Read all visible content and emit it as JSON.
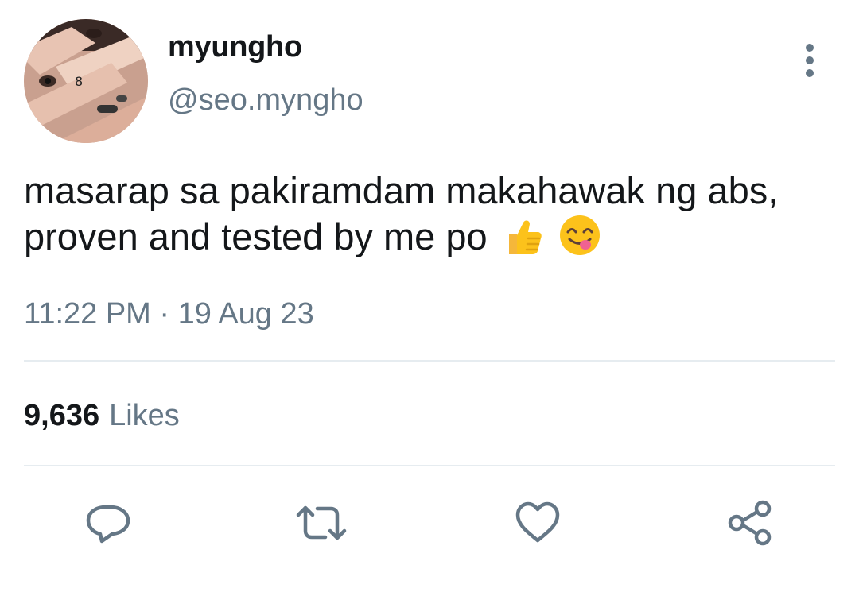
{
  "tweet": {
    "display_name": "myungho",
    "handle": "@seo.myngho",
    "text": "masarap sa pakiramdam makahawak ng abs, proven and tested by me po",
    "emojis": [
      "thumbs-up-emoji",
      "face-savoring-food-emoji"
    ],
    "timestamp": "11:22 PM · 19 Aug 23",
    "likes_count": "9,636",
    "likes_label": "Likes"
  },
  "icons": {
    "more": "more-vertical-icon",
    "reply": "reply-icon",
    "retweet": "retweet-icon",
    "like": "heart-icon",
    "share": "share-icon"
  },
  "colors": {
    "text_primary": "#14171a",
    "text_secondary": "#657786",
    "divider": "#e6ecf0",
    "icon": "#657786"
  }
}
